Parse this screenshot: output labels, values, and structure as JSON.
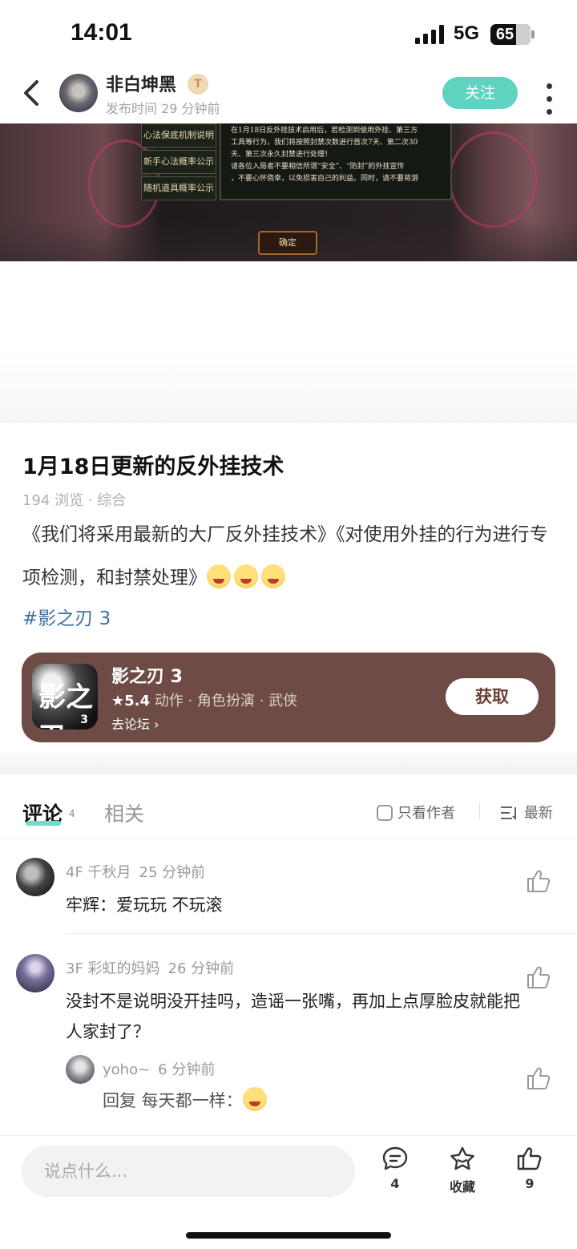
{
  "status_bar": {
    "time": "14:01",
    "network": "5G",
    "battery": "65",
    "battery_level": 0.65
  },
  "header": {
    "author_name": "非白坤黑",
    "badge_text": "T",
    "publish_time": "发布时间 29 分钟前",
    "follow_label": "关注"
  },
  "image": {
    "menu_items": [
      "心法保底机制说明",
      "新手心法概率公示",
      "随机道具概率公示"
    ],
    "panel_lines": [
      "在1月18日反外挂技术启用后，若检测到使用外挂、第三方",
      "工具等行为，我们将按照封禁次数进行首次7天、第二次30",
      "天、第三次永久封禁进行处理！",
      "请各位入局者不要相信所谓“安全”、“防封”的外挂宣传",
      "，不要心怀侥幸，以免损害自己的利益。同时，请不要将游"
    ],
    "confirm_label": "确定"
  },
  "post": {
    "title": "1月18日更新的反外挂技术",
    "meta": "194 浏览 · 综合",
    "content": "《我们将采用最新的大厂反外挂技术》《对使用外挂的行为进行专项检测，和封禁处理》",
    "emoji_count": 3,
    "hashtag": "#影之刃 3"
  },
  "game_card": {
    "icon_text": "影之刃",
    "icon_num": "3",
    "name": "影之刃 3",
    "rating": "★5.4",
    "tags": " 动作 · 角色扮演 · 武侠",
    "forum_link": "去论坛 ›",
    "get_label": "获取"
  },
  "tabs": {
    "comments_label": "评论",
    "comments_count": "4",
    "related_label": "相关",
    "only_author_label": "只看作者",
    "sort_label": "最新"
  },
  "comments": [
    {
      "floor_user": "4F 千秋月",
      "time": "25 分钟前",
      "text": "牢辉：爱玩玩 不玩滚"
    },
    {
      "floor_user": "3F 彩虹的妈妈",
      "time": "26 分钟前",
      "text": "没封不是说明没开挂吗，造谣一张嘴，再加上点厚脸皮就能把人家封了？"
    }
  ],
  "reply": {
    "user": "yoho~",
    "time": "6 分钟前",
    "text": "回复 每天都一样："
  },
  "bottom_bar": {
    "input_placeholder": "说点什么...",
    "comment_count": "4",
    "favorite_label": "收藏",
    "like_count": "9"
  },
  "colors": {
    "accent": "#5fd3c0",
    "card_bg": "#6e4b44",
    "hashtag": "#3e73a8"
  }
}
